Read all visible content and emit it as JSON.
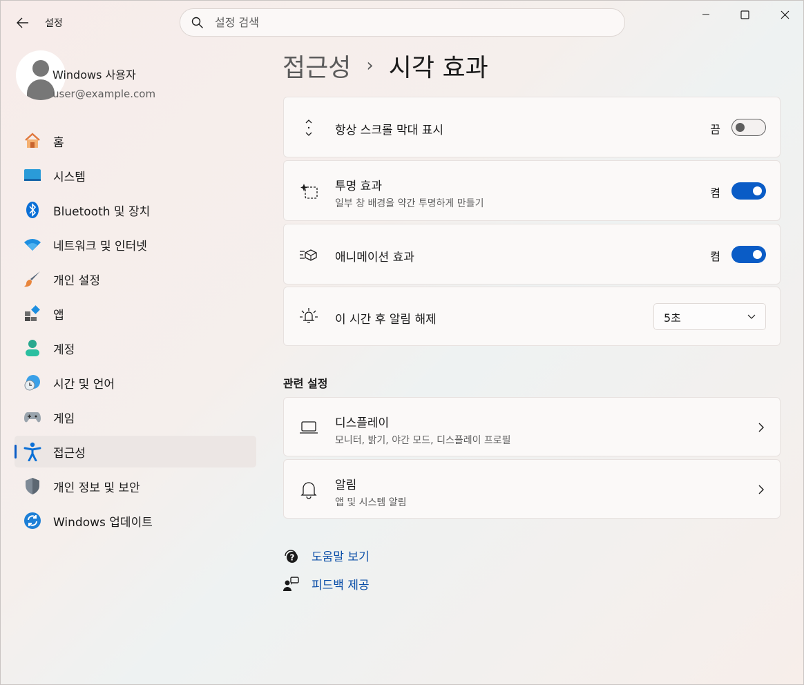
{
  "window": {
    "title": "설정",
    "controls": [
      "minimize-icon",
      "maximize-icon",
      "close-icon"
    ]
  },
  "search": {
    "placeholder": "설정 검색",
    "value": ""
  },
  "user": {
    "name": "Windows 사용자",
    "email": "user@example.com"
  },
  "sidebar": {
    "items": [
      {
        "label": "홈",
        "icon": "home-icon"
      },
      {
        "label": "시스템",
        "icon": "system-icon"
      },
      {
        "label": "Bluetooth 및 장치",
        "icon": "bluetooth-icon"
      },
      {
        "label": "네트워크 및 인터넷",
        "icon": "wifi-icon"
      },
      {
        "label": "개인 설정",
        "icon": "brush-icon"
      },
      {
        "label": "앱",
        "icon": "apps-icon"
      },
      {
        "label": "계정",
        "icon": "account-icon"
      },
      {
        "label": "시간 및 언어",
        "icon": "time-language-icon"
      },
      {
        "label": "게임",
        "icon": "gamepad-icon"
      },
      {
        "label": "접근성",
        "icon": "accessibility-icon",
        "active": true
      },
      {
        "label": "개인 정보 및 보안",
        "icon": "shield-icon"
      },
      {
        "label": "Windows 업데이트",
        "icon": "update-icon"
      }
    ]
  },
  "breadcrumb": {
    "parent": "접근성",
    "separator": "›",
    "current": "시각 효과"
  },
  "settings": [
    {
      "title": "항상 스크롤 막대 표시",
      "subtitle": "",
      "state": "끔",
      "on": false,
      "icon": "scrollbar-icon"
    },
    {
      "title": "투명 효과",
      "subtitle": "일부 창 배경을 약간 투명하게 만들기",
      "state": "켬",
      "on": true,
      "icon": "transparency-icon"
    },
    {
      "title": "애니메이션 효과",
      "subtitle": "",
      "state": "켬",
      "on": true,
      "icon": "animation-icon"
    },
    {
      "title": "이 시간 후 알림 해제",
      "subtitle": "",
      "select_value": "5초",
      "icon": "notification-dismiss-icon"
    }
  ],
  "related": {
    "title": "관련 설정",
    "items": [
      {
        "title": "디스플레이",
        "subtitle": "모니터, 밝기, 야간 모드, 디스플레이 프로필",
        "icon": "laptop-icon"
      },
      {
        "title": "알림",
        "subtitle": "앱 및 시스템 알림",
        "icon": "bell-icon"
      }
    ]
  },
  "links": [
    {
      "label": "도움말 보기",
      "icon": "help-icon"
    },
    {
      "label": "피드백 제공",
      "icon": "feedback-icon"
    }
  ],
  "colors": {
    "accent": "#0a5cc6",
    "link": "#0a4ea8"
  }
}
